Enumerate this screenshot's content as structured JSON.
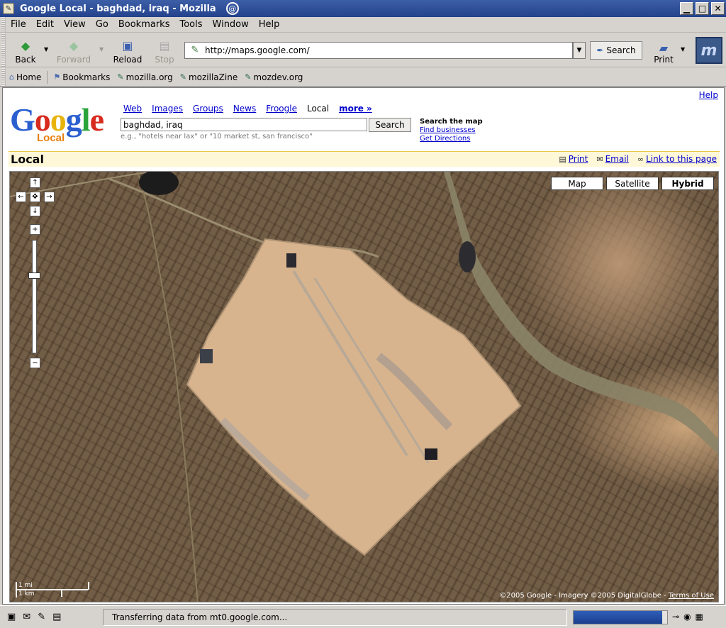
{
  "window": {
    "title": "Google Local - baghdad, iraq - Mozilla"
  },
  "menu": [
    "File",
    "Edit",
    "View",
    "Go",
    "Bookmarks",
    "Tools",
    "Window",
    "Help"
  ],
  "nav": {
    "back": "Back",
    "forward": "Forward",
    "reload": "Reload",
    "stop": "Stop",
    "url": "http://maps.google.com/",
    "search": "Search",
    "print": "Print"
  },
  "bookmarks": [
    "Home",
    "Bookmarks",
    "mozilla.org",
    "mozillaZine",
    "mozdev.org"
  ],
  "page": {
    "help": "Help",
    "logo_local": "Local",
    "tabs": [
      "Web",
      "Images",
      "Groups",
      "News",
      "Froogle",
      "Local",
      "more »"
    ],
    "query": "baghdad, iraq",
    "search_button": "Search",
    "hint": "e.g., \"hotels near lax\" or \"10 market st, san francisco\"",
    "search_the_map": "Search the map",
    "find_businesses": "Find businesses",
    "get_directions": "Get Directions",
    "section_title": "Local",
    "actions": {
      "print": "Print",
      "email": "Email",
      "link": "Link to this page"
    }
  },
  "map": {
    "types": [
      "Map",
      "Satellite",
      "Hybrid"
    ],
    "selected_type": "Hybrid",
    "scale_mi": "1 mi",
    "scale_km": "1 km",
    "copyright": "©2005 Google - Imagery ©2005 DigitalGlobe - ",
    "terms": "Terms of Use"
  },
  "status": {
    "text": "Transferring data from mt0.google.com...",
    "progress": 0.95
  },
  "colors": {
    "titlebar": "#2a4a92",
    "link": "#0000cc",
    "local_orange": "#e87e0c",
    "local_bar": "#fff8d8"
  }
}
